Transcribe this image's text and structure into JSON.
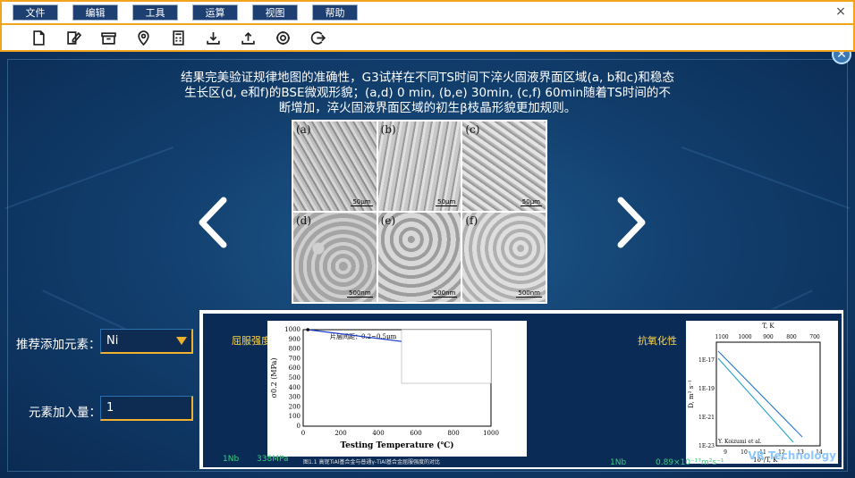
{
  "menu": {
    "items": [
      "文件",
      "编辑",
      "工具",
      "运算",
      "视图",
      "帮助"
    ],
    "close_glyph": "×"
  },
  "toolbar": {
    "icons": [
      "new-file-icon",
      "edit-icon",
      "archive-icon",
      "location-icon",
      "calculator-icon",
      "download-icon",
      "upload-icon",
      "settings-icon",
      "logout-icon"
    ]
  },
  "slide": {
    "description": "结果完美验证规律地图的准确性，G3试样在不同TS时间下淬火固液界面区域(a, b和c)和稳态生长区(d, e和f)的BSE微观形貌；(a,d) 0 min, (b,e) 30min, (c,f) 60min随着TS时间的不断增加，淬火固液界面区域的初生β枝晶形貌更加规则。",
    "micrograph_labels": [
      "(a)",
      "(b)",
      "(c)",
      "(d)",
      "(e)",
      "(f)"
    ],
    "scale_bars": [
      "50μm",
      "50μm",
      "50μm",
      "500nm",
      "500nm",
      "500nm"
    ]
  },
  "form": {
    "element_label": "推荐添加元素：",
    "element_value": "Ni",
    "amount_label": "元素加入量：",
    "amount_value": "1"
  },
  "panel": {
    "left_title": "屈服强度",
    "right_title": "抗氧化性",
    "left_footer_element": "1Nb",
    "left_footer_value": "338MPa",
    "caption": "图1.1 高铌TiAl基合金与普通γ-TiAl基合金屈服强度的对比",
    "right_footer_element": "1Nb",
    "right_footer_value": "0.89×10⁻¹⁷m²s⁻¹",
    "brand": "VR Technology"
  },
  "chart_data": [
    {
      "type": "line",
      "title": "",
      "annotation": "片层间距：0.2~0.5μm",
      "xlabel": "Testing Temperature (℃)",
      "ylabel": "σ0.2 (MPa)",
      "xlim": [
        0,
        1000
      ],
      "ylim": [
        0,
        1000
      ],
      "xticks": [
        0,
        200,
        400,
        600,
        800,
        1000
      ],
      "yticks": [
        0,
        100,
        200,
        300,
        400,
        500,
        600,
        700,
        800,
        900,
        1000
      ],
      "series": [
        {
          "name": "",
          "x": [
            25,
            600,
            750,
            800,
            900
          ],
          "y": [
            1000,
            860,
            700,
            680,
            600
          ]
        }
      ]
    },
    {
      "type": "line",
      "title": "",
      "xlabel": "10⁴/T, K⁻¹",
      "ylabel": "D, m² s⁻¹",
      "top_axis_label": "T, K",
      "top_ticks": [
        "1100",
        "1000",
        "900",
        "800",
        "700"
      ],
      "yticks": [
        "1E-17",
        "1E-19",
        "1E-21",
        "1E-23"
      ],
      "xticks": [
        "9",
        "10",
        "11",
        "12",
        "13",
        "14"
      ],
      "annotation": "Y. Koizumi et al."
    }
  ]
}
